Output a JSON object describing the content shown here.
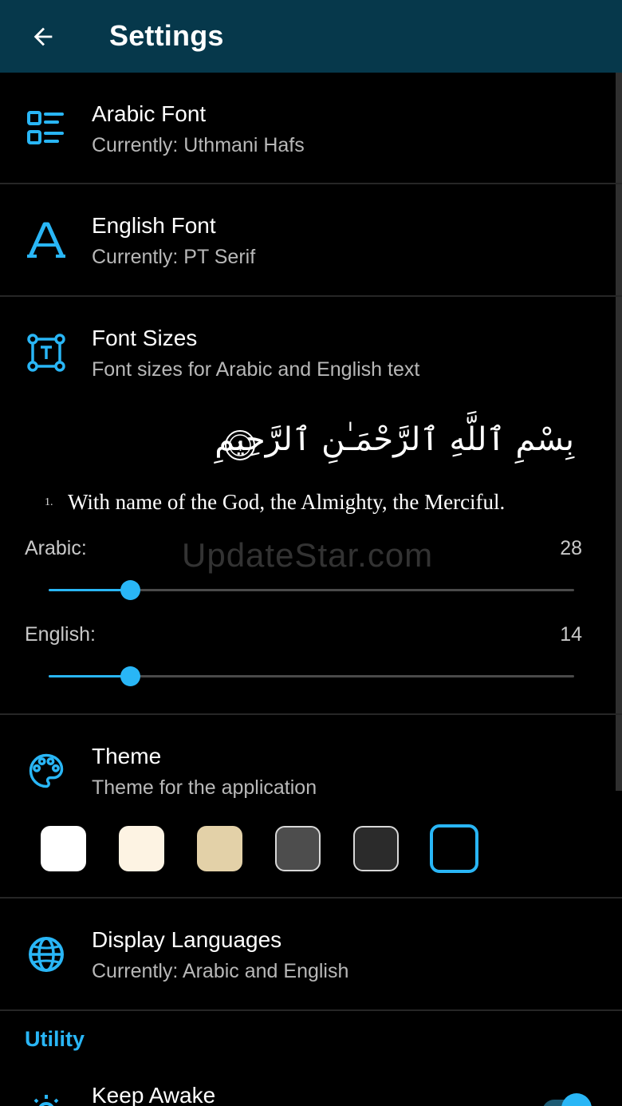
{
  "appbar": {
    "title": "Settings"
  },
  "settings": {
    "arabic_font": {
      "title": "Arabic Font",
      "subtitle": "Currently: Uthmani Hafs"
    },
    "english_font": {
      "title": "English Font",
      "subtitle": "Currently: PT Serif"
    },
    "font_sizes": {
      "title": "Font Sizes",
      "subtitle": "Font sizes for Arabic and English text",
      "preview_arabic": "بِسْمِ ٱللَّهِ ٱلرَّحْمَـٰنِ ٱلرَّحِيمِ",
      "preview_ayah_number": "١",
      "preview_verse_number": "1.",
      "preview_english": "With name of the God, the Almighty, the Merciful.",
      "arabic_label": "Arabic:",
      "arabic_value": "28",
      "arabic_fraction": 0.155,
      "english_label": "English:",
      "english_value": "14",
      "english_fraction": 0.155
    },
    "theme": {
      "title": "Theme",
      "subtitle": "Theme for the application",
      "swatches": [
        {
          "name": "white",
          "color": "#ffffff",
          "border": "#ffffff"
        },
        {
          "name": "cream",
          "color": "#fdf3e3",
          "border": "#fdf3e3"
        },
        {
          "name": "sepia",
          "color": "#e3d1a8",
          "border": "#e3d1a8"
        },
        {
          "name": "gray",
          "color": "#4d4d4d",
          "border": "#d8d8d8"
        },
        {
          "name": "dark-gray",
          "color": "#2b2b2b",
          "border": "#d8d8d8"
        },
        {
          "name": "black",
          "color": "#000000",
          "border": "#29b6f6",
          "selected": true
        }
      ]
    },
    "display_languages": {
      "title": "Display Languages",
      "subtitle": "Currently: Arabic and English"
    }
  },
  "utility": {
    "section_title": "Utility",
    "keep_awake": {
      "title": "Keep Awake",
      "enabled": true
    }
  },
  "watermark": "UpdateStar.com",
  "colors": {
    "accent": "#29b6f6",
    "appbar": "#06384b",
    "background": "#000000"
  }
}
